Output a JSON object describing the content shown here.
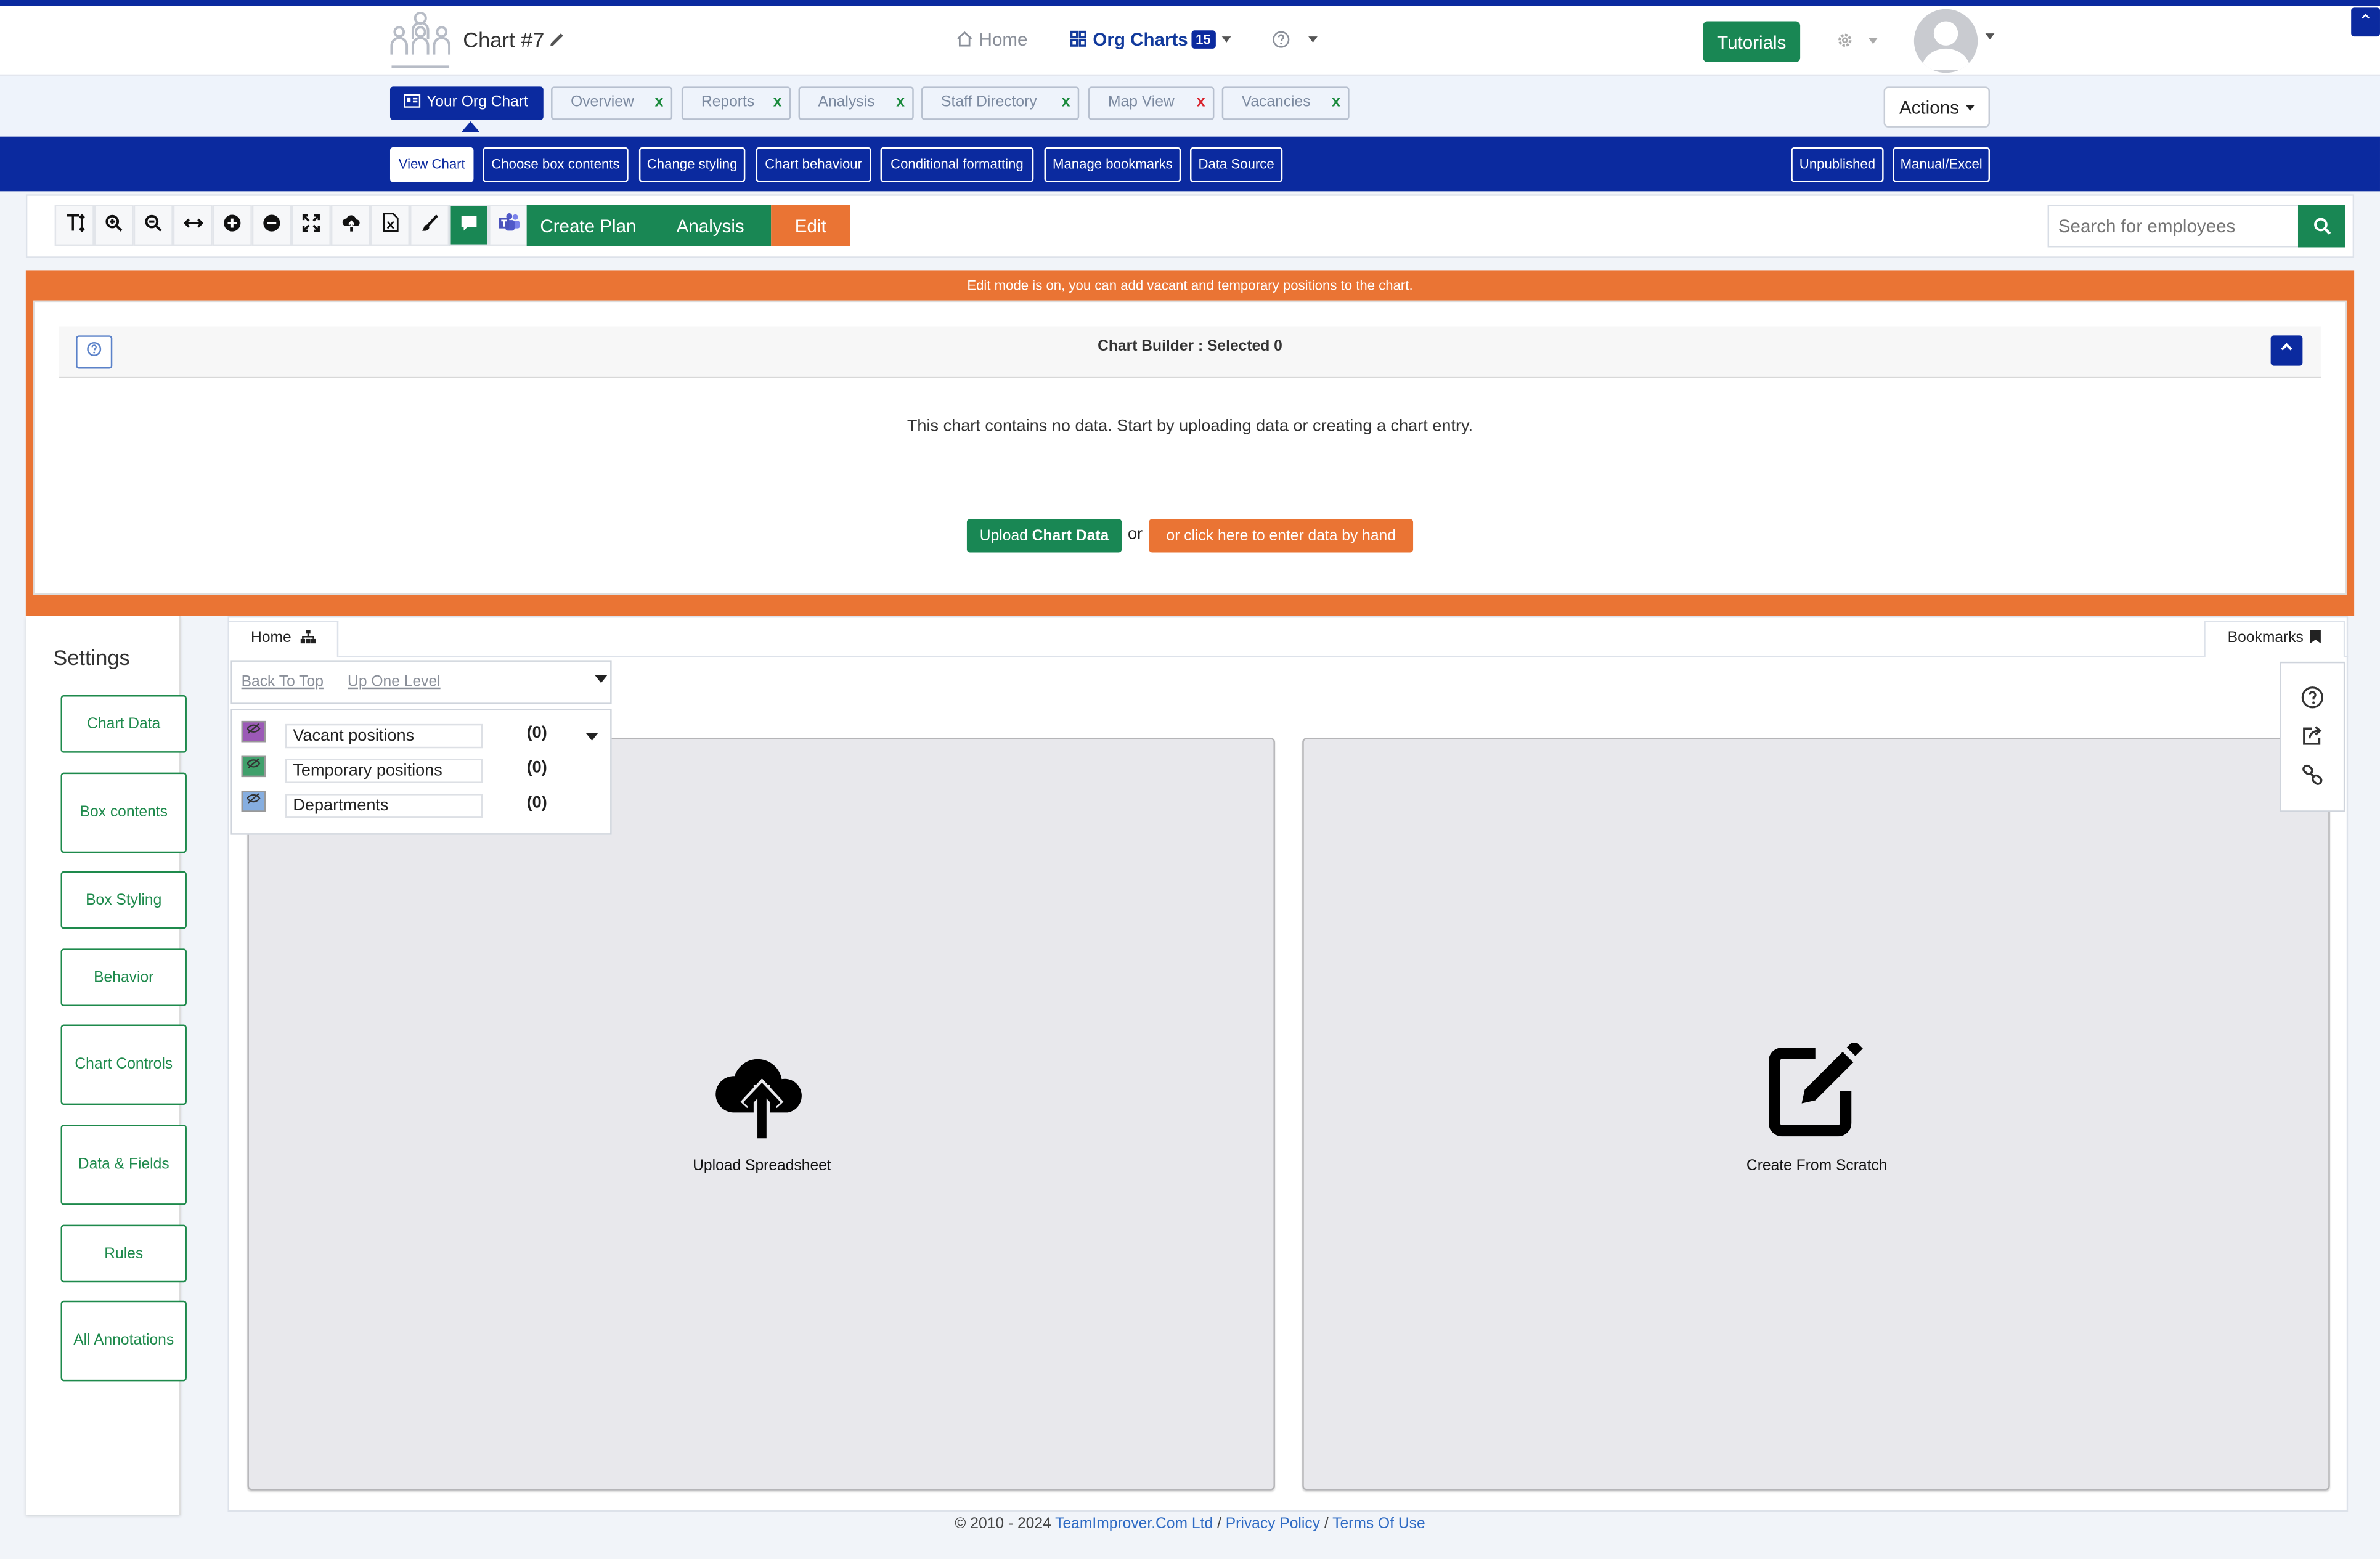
{
  "header": {
    "chart_title": "Chart #7",
    "nav_home": "Home",
    "nav_org_charts": "Org Charts",
    "org_chart_count": "15",
    "tutorials_label": "Tutorials",
    "collapse_glyph": "⌃"
  },
  "tabs": [
    {
      "label": "Your Org Chart",
      "active": true
    },
    {
      "label": "Overview",
      "mark": "x"
    },
    {
      "label": "Reports",
      "mark": "x"
    },
    {
      "label": "Analysis",
      "mark": "x"
    },
    {
      "label": "Staff Directory",
      "mark": "x"
    },
    {
      "label": "Map View",
      "mark": "x"
    },
    {
      "label": "Vacancies",
      "mark": "x"
    }
  ],
  "actions_label": "Actions",
  "subnav": {
    "view_chart": "View Chart",
    "choose_box_contents": "Choose box contents",
    "change_styling": "Change styling",
    "chart_behaviour": "Chart behaviour",
    "conditional_formatting": "Conditional formatting",
    "manage_bookmarks": "Manage bookmarks",
    "data_source": "Data Source",
    "unpublished": "Unpublished",
    "manual_excel": "Manual/Excel"
  },
  "toolbar": {
    "create_plan": "Create Plan",
    "analysis": "Analysis",
    "edit": "Edit",
    "search_placeholder": "Search for employees"
  },
  "edit_notice": "Edit mode is on, you can add vacant and temporary positions to the chart.",
  "builder": {
    "title": "Chart Builder : Selected 0",
    "empty_message": "This chart contains no data. Start by uploading data or creating a chart entry.",
    "upload_prefix": "Upload ",
    "upload_bold": "Chart Data",
    "or": "or",
    "enter_by_hand": "or click here to enter data by hand"
  },
  "settings": {
    "title": "Settings",
    "items": [
      "Chart Data",
      "Box contents",
      "Box Styling",
      "Behavior",
      "Chart Controls",
      "Data & Fields",
      "Rules",
      "All Annotations"
    ]
  },
  "main": {
    "home_tab": "Home",
    "bookmarks_tab": "Bookmarks",
    "back_to_top": "Back To Top",
    "up_one_level": "Up One Level",
    "legend": [
      {
        "name": "Vacant positions",
        "count": "(0)",
        "color": "#9b59b6"
      },
      {
        "name": "Temporary positions",
        "count": "(0)",
        "color": "#3fa06b"
      },
      {
        "name": "Departments",
        "count": "(0)",
        "color": "#86aee0"
      }
    ],
    "upload_spreadsheet": "Upload Spreadsheet",
    "create_from_scratch": "Create From Scratch"
  },
  "footer": {
    "copyright": "© 2010 - 2024 ",
    "company": "TeamImprover.Com Ltd",
    "sep1": " / ",
    "privacy": "Privacy Policy",
    "sep2": " / ",
    "terms": "Terms Of Use"
  },
  "colors": {
    "brand_blue": "#0b2a9f",
    "green": "#198754",
    "orange": "#ea7434"
  }
}
